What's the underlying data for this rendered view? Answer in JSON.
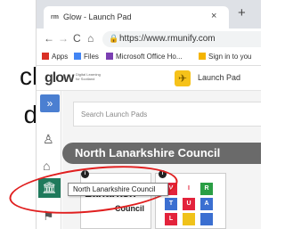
{
  "slide": {
    "line1": "ck",
    "line2": "d."
  },
  "browser": {
    "tab_title": "Glow - Launch Pad",
    "tab_favicon": "rm",
    "tab_close": "×",
    "new_tab": "+",
    "url": "https://www.rmunify.com",
    "nav": {
      "back": "←",
      "forward": "→",
      "reload": "C",
      "home": "⌂"
    },
    "lock": "🔒"
  },
  "bookmarks": [
    {
      "label": "Apps",
      "color": "#d93025"
    },
    {
      "label": "Files",
      "color": "#4285f4"
    },
    {
      "label": "Microsoft Office Ho...",
      "color": "#7b3fb2"
    },
    {
      "label": "Sign in to you",
      "color": "#f4b400"
    }
  ],
  "glow": {
    "logo_main": "glow",
    "subtitle": "Digital Learning for Scotland",
    "launch_label": "Launch Pad"
  },
  "sidebar": {
    "expand": "»",
    "user_icon": "user-icon",
    "home_icon": "home-icon",
    "council_icon": "building-icon",
    "flag_icon": "flag-icon"
  },
  "content": {
    "search_placeholder": "Search Launch Pads",
    "council_title": "North Lanarkshire Council",
    "tile1_logo": "Lanarksh",
    "tile1_sub": "Council",
    "tooltip": "North Lanarkshire Council",
    "grid_letters": [
      "V",
      "I",
      "R",
      "T",
      "U",
      "A",
      "L",
      "",
      ""
    ],
    "grid_colors": [
      "#e3233c",
      "#ffffff",
      "#2a9e45",
      "#3b6fd1",
      "#e3233c",
      "#3b6fd1",
      "#e3233c",
      "#f0c21a",
      "#3b6fd1"
    ]
  },
  "annotation": {
    "ring_color": "#e01f1f"
  }
}
